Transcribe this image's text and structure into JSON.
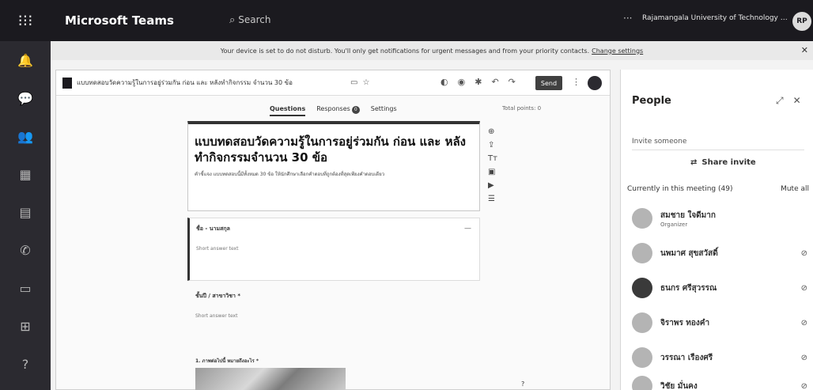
{
  "topbar": {
    "app_title": "Microsoft Teams",
    "search_placeholder": "Search",
    "more": "···",
    "org_name": "Rajamangala University of Technology Tha...",
    "avatar_initials": "RP"
  },
  "banner": {
    "text": "Your device is set to do not disturb. You'll only get notifications for urgent messages and from your priority contacts.",
    "link": "Change settings"
  },
  "document": {
    "title": "แบบทดสอบวัดความรู้ในการอยู่ร่วมกัน ก่อน และ หลังทำกิจกรรม จำนวน 30 ข้อ",
    "send_label": "Send",
    "tabs": [
      {
        "label": "Questions",
        "active": true
      },
      {
        "label": "Responses",
        "active": false,
        "badge": "0"
      },
      {
        "label": "Settings",
        "active": false
      }
    ],
    "total_points": "Total points: 0",
    "form_title": "แบบทดสอบวัดความรู้ในการอยู่ร่วมกัน ก่อน และ หลังทำกิจกรรมจำนวน 30 ข้อ",
    "form_description": "คำชี้แจง แบบทดสอบนี้มีทั้งหมด 30 ข้อ ให้นักศึกษาเลือกคำตอบที่ถูกต้องที่สุดเพียงคำตอบเดียว",
    "q1_label": "ชื่อ - นามสกุล",
    "q1_placeholder": "Short answer text",
    "q2_label": "ชั้นปี / สาขาวิชา *",
    "q2_placeholder": "Short answer text",
    "q3_label": "1. ภาพต่อไปนี้ หมายถึงอะไร *"
  },
  "people": {
    "title": "People",
    "invite_placeholder": "Invite someone",
    "share_invite": "Share invite",
    "in_meeting_label": "Currently in this meeting (49)",
    "mute_all": "Mute all",
    "members": [
      {
        "name": "สมชาย ใจดีมาก",
        "role": "Organizer"
      },
      {
        "name": "นพมาศ สุขสวัสดิ์",
        "role": ""
      },
      {
        "name": "ธนกร ศรีสุวรรณ",
        "role": ""
      },
      {
        "name": "จิราพร ทองคำ",
        "role": ""
      },
      {
        "name": "วรรณา เรืองศรี",
        "role": ""
      },
      {
        "name": "วิชัย มั่นคง",
        "role": ""
      }
    ]
  }
}
